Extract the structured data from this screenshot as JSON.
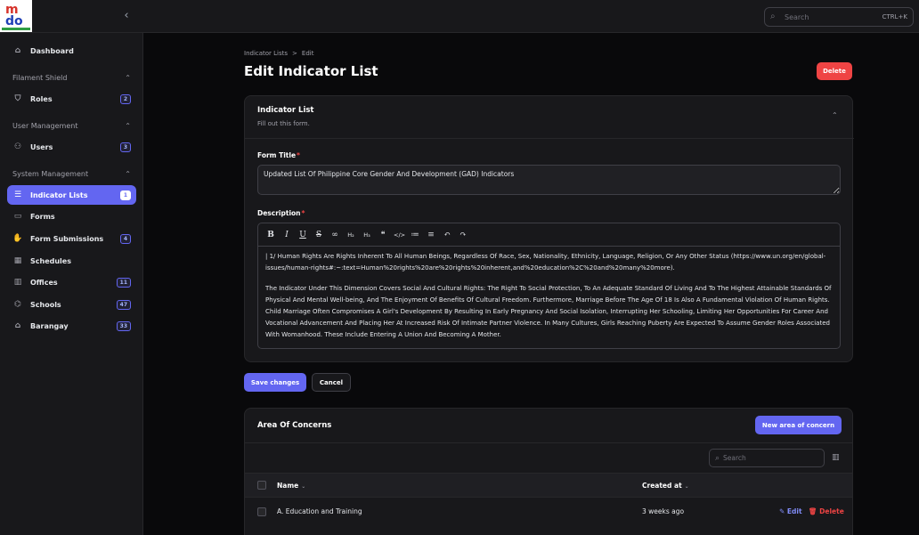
{
  "app": {
    "logo_top": "m",
    "logo_bottom": "do",
    "search_placeholder": "Search",
    "search_shortcut": "CTRL+K"
  },
  "sidebar": {
    "dashboard": {
      "label": "Dashboard",
      "icon": "home-icon"
    },
    "groups": [
      {
        "label": "Filament Shield"
      },
      {
        "label": "User Management"
      },
      {
        "label": "System Management"
      }
    ],
    "items": [
      {
        "label": "Roles",
        "badge": "2",
        "icon": "shield-icon"
      },
      {
        "label": "Users",
        "badge": "3",
        "icon": "users-icon"
      },
      {
        "label": "Indicator Lists",
        "badge": "1",
        "icon": "list-icon",
        "active": true
      },
      {
        "label": "Forms",
        "icon": "inbox-icon"
      },
      {
        "label": "Form Submissions",
        "badge": "4",
        "icon": "hand-icon"
      },
      {
        "label": "Schedules",
        "icon": "calendar-icon"
      },
      {
        "label": "Offices",
        "badge": "11",
        "icon": "building-icon"
      },
      {
        "label": "Schools",
        "badge": "47",
        "icon": "academic-cap-icon"
      },
      {
        "label": "Barangay",
        "badge": "33",
        "icon": "home-icon"
      }
    ]
  },
  "main": {
    "breadcrumb": [
      "Indicator Lists",
      ">",
      "Edit"
    ],
    "title": "Edit Indicator List",
    "delete_label": "Delete",
    "form": {
      "section_title": "Indicator List",
      "section_subtitle": "Fill out this form.",
      "title_label": "Form Title",
      "title_value": "Updated List Of Philippine Core Gender And Development (GAD) Indicators",
      "description_label": "Description",
      "description_p1": "| 1/ Human Rights Are Rights Inherent To All Human Beings, Regardless Of Race, Sex, Nationality, Ethnicity, Language, Religion, Or Any Other Status (https://www.un.org/en/global-issues/human-rights#:~:text=Human%20rights%20are%20rights%20inherent,and%20education%2C%20and%20many%20more).",
      "description_p2": "The Indicator Under This Dimension Covers Social And Cultural Rights: The Right To Social Protection, To An Adequate Standard Of Living And To The Highest Attainable Standards Of Physical And Mental Well-being, And The Enjoyment Of Benefits Of Cultural Freedom. Furthermore, Marriage Before The Age Of 18 Is Also A Fundamental Violation Of Human Rights. Child Marriage Often Compromises A Girl's Development By Resulting In Early Pregnancy And Social Isolation, Interrupting Her Schooling, Limiting Her Opportunities For Career And Vocational Advancement And Placing Her At Increased Risk Of Intimate Partner Violence. In Many Cultures, Girls Reaching Puberty Are Expected To Assume Gender Roles Associated With Womanhood. These Include Entering A Union And Becoming A Mother."
    },
    "save_label": "Save changes",
    "cancel_label": "Cancel",
    "concerns": {
      "title": "Area Of Concerns",
      "new_label": "New area of concern",
      "search_placeholder": "Search",
      "col_name": "Name",
      "col_created": "Created at",
      "rows": [
        {
          "name": "A. Education and Training",
          "created": "3 weeks ago",
          "edit": "Edit",
          "delete": "Delete"
        }
      ]
    }
  },
  "colors": {
    "accent": "#6366f1",
    "danger": "#ef4444"
  }
}
